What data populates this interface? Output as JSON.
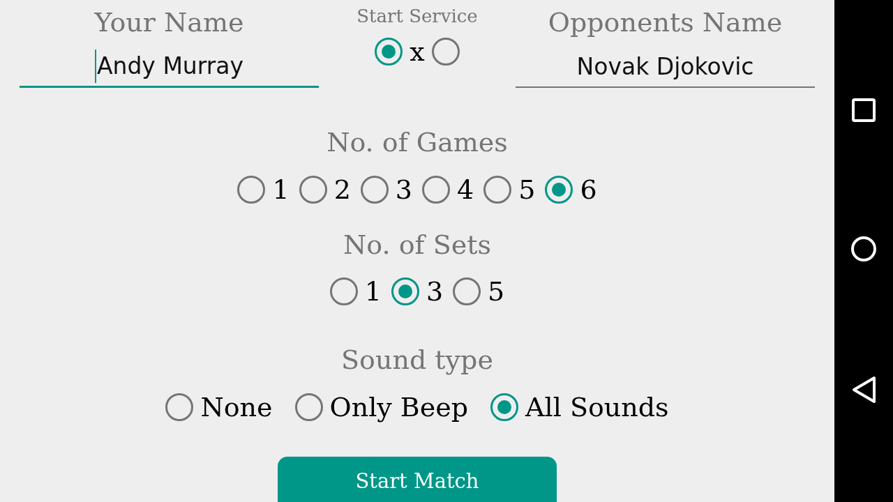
{
  "your_name": {
    "label": "Your Name",
    "value": "Andy Murray",
    "focused": true
  },
  "start_service": {
    "label": "Start Service",
    "separator": "x",
    "options": [
      {
        "selected": true
      },
      {
        "selected": false
      }
    ]
  },
  "opponent_name": {
    "label": "Opponents Name",
    "value": "Novak Djokovic",
    "focused": false
  },
  "games": {
    "label": "No. of Games",
    "options": [
      {
        "label": "1",
        "selected": false
      },
      {
        "label": "2",
        "selected": false
      },
      {
        "label": "3",
        "selected": false
      },
      {
        "label": "4",
        "selected": false
      },
      {
        "label": "5",
        "selected": false
      },
      {
        "label": "6",
        "selected": true
      }
    ]
  },
  "sets": {
    "label": "No. of Sets",
    "options": [
      {
        "label": "1",
        "selected": false
      },
      {
        "label": "3",
        "selected": true
      },
      {
        "label": "5",
        "selected": false
      }
    ]
  },
  "sound": {
    "label": "Sound type",
    "options": [
      {
        "label": "None",
        "selected": false
      },
      {
        "label": "Only Beep",
        "selected": false
      },
      {
        "label": "All Sounds",
        "selected": true
      }
    ]
  },
  "start_button": "Start Match"
}
